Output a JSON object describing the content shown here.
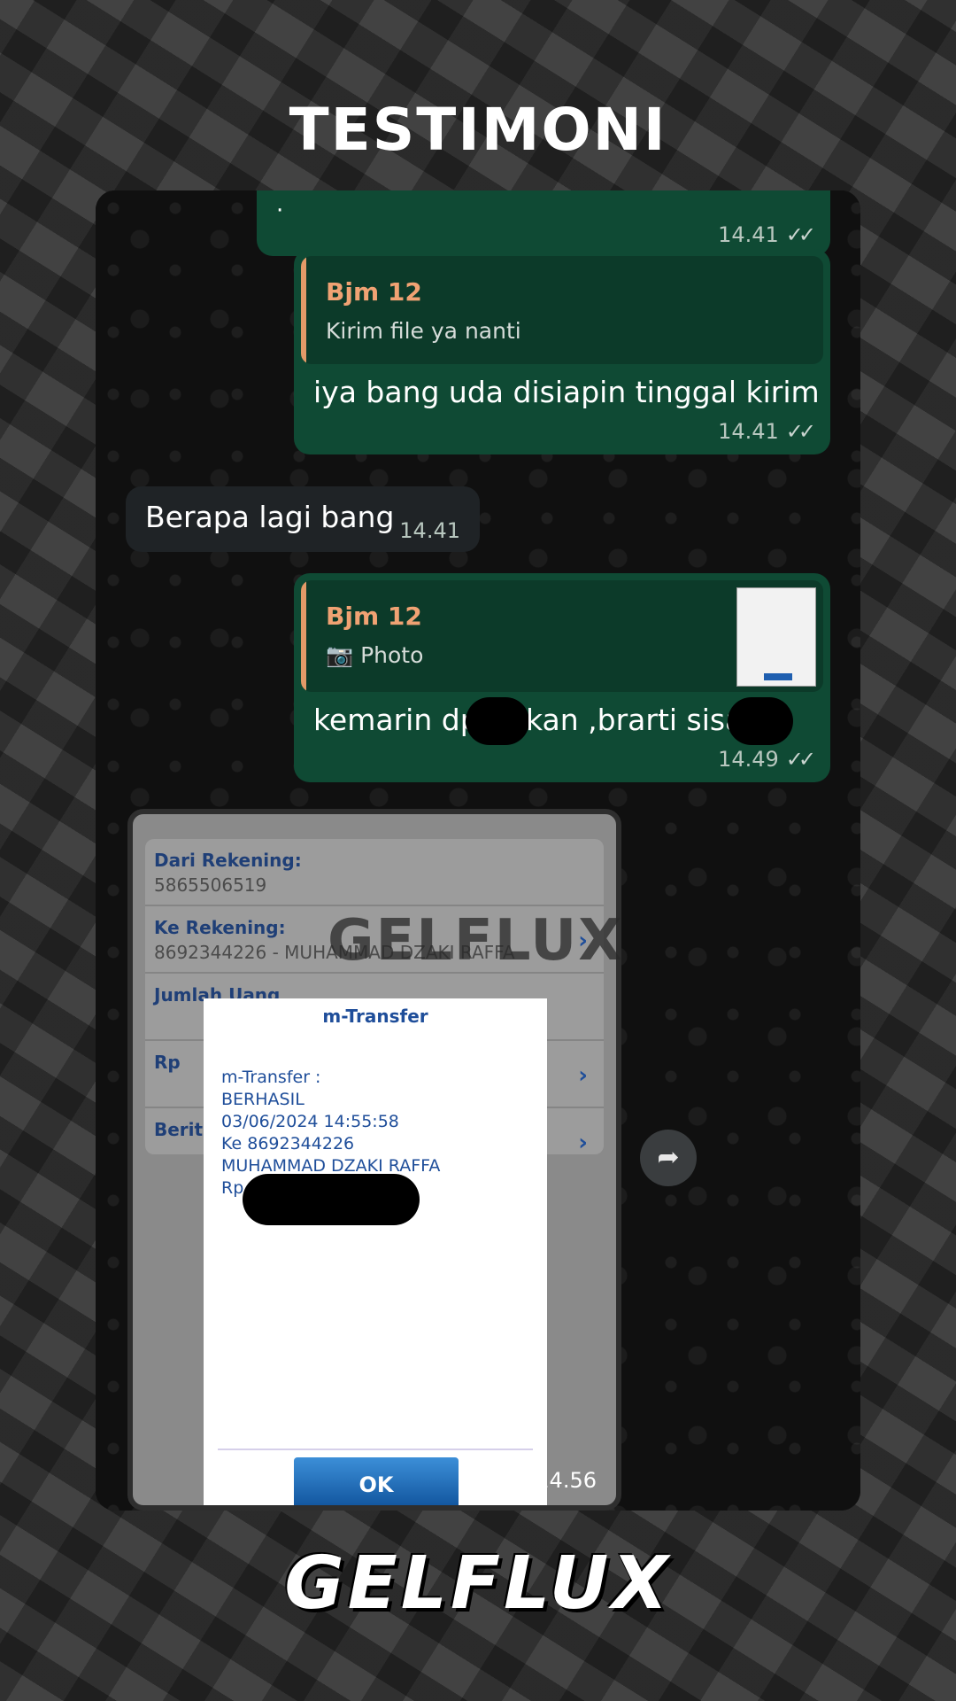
{
  "page_title": "TESTIMONI",
  "brand_footer": "GELFLUX",
  "watermark": "GELFLUX",
  "messages": [
    {
      "type": "outgoing",
      "text": "·",
      "time": "14.41",
      "status": "read"
    },
    {
      "type": "outgoing",
      "quote_author": "Bjm 12",
      "quote_text": "Kirim file ya nanti",
      "text": "iya bang uda disiapin tinggal kirim",
      "time": "14.41",
      "status": "read"
    },
    {
      "type": "incoming",
      "text": "Berapa lagi bang",
      "time": "14.41"
    },
    {
      "type": "outgoing",
      "quote_author": "Bjm 12",
      "quote_text": "Photo",
      "quote_icon": "camera-icon",
      "text_part1": "kemarin dp",
      "text_part2": "kan ,brarti sisa",
      "time": "14.49",
      "status": "read"
    }
  ],
  "photo": {
    "time": "14.56",
    "form": {
      "rows": [
        {
          "label": "Dari Rekening:",
          "value": "5865506519"
        },
        {
          "label": "Ke Rekening:",
          "value": "8692344226 - MUHAMMAD DZAKI RAFFA"
        },
        {
          "label": "Jumlah Uang",
          "value": ""
        },
        {
          "label": "Rp",
          "value": ""
        },
        {
          "label": "Berita",
          "value": ""
        }
      ]
    },
    "dialog": {
      "title": "m-Transfer",
      "lines": [
        "m-Transfer :",
        "BERHASIL",
        "03/06/2024 14:55:58",
        "Ke 8692344226",
        "MUHAMMAD DZAKI RAFFA",
        "Rp"
      ],
      "ok_label": "OK"
    }
  },
  "icons": {
    "forward": "forward-icon",
    "ticks": "double-check-icon"
  },
  "colors": {
    "outgoing_bubble": "#0f4a34",
    "incoming_bubble": "#1f2326",
    "quote_accent": "#e39a68",
    "bank_blue": "#1f4e9a"
  }
}
